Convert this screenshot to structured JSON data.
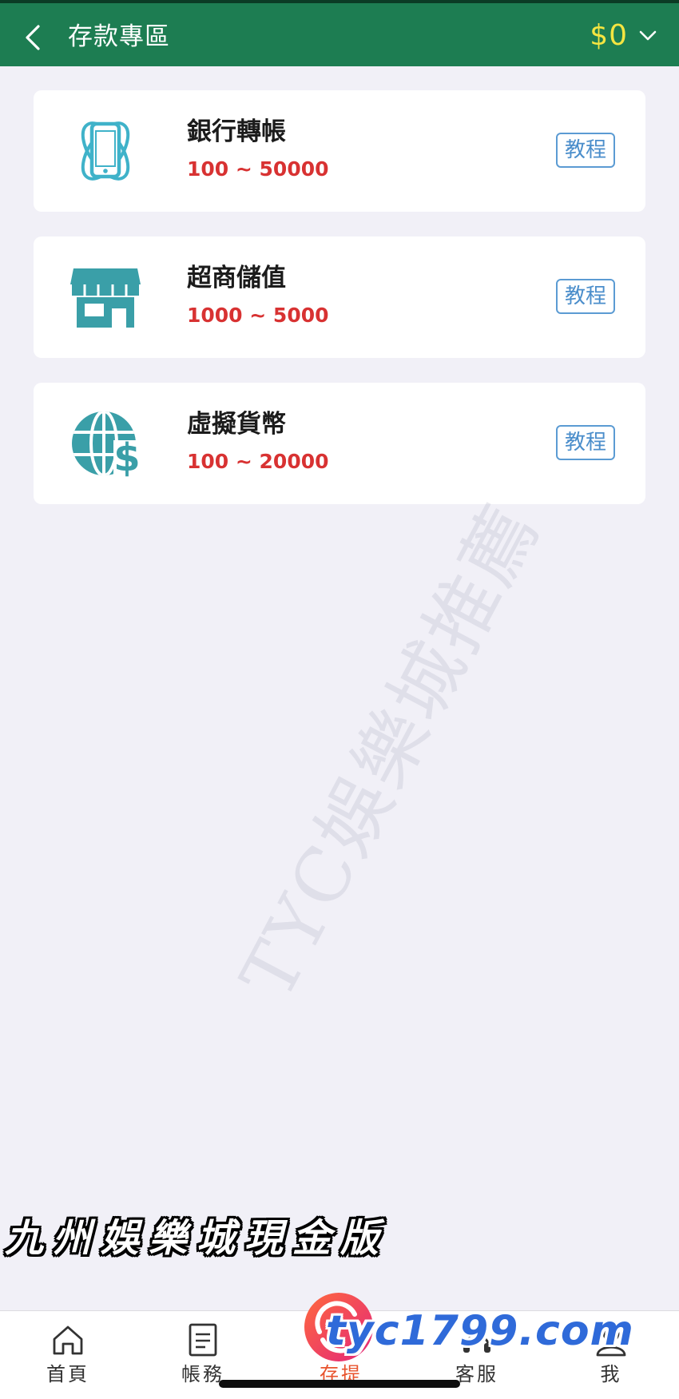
{
  "header": {
    "title": "存款專區",
    "balance": "$0"
  },
  "deposit_methods": [
    {
      "name": "銀行轉帳",
      "range": "100 ~ 50000",
      "tutorial_label": "教程",
      "icon": "phone-transfer-icon"
    },
    {
      "name": "超商儲值",
      "range": "1000 ~ 5000",
      "tutorial_label": "教程",
      "icon": "store-icon"
    },
    {
      "name": "虛擬貨幣",
      "range": "100 ~ 20000",
      "tutorial_label": "教程",
      "icon": "globe-dollar-icon"
    }
  ],
  "bottom_nav": {
    "items": [
      {
        "label": "首頁",
        "icon": "home-icon"
      },
      {
        "label": "帳務",
        "icon": "document-icon"
      },
      {
        "label": "存提",
        "icon": "deposit-icon",
        "active": true
      },
      {
        "label": "客服",
        "icon": "support-icon"
      },
      {
        "label": "我",
        "icon": "user-icon"
      }
    ]
  },
  "watermarks": {
    "diagonal": "TYC娛樂城推薦",
    "bottom_left": "九州娛樂城現金版",
    "bottom_right": "tyc1799.com"
  },
  "colors": {
    "header_bg": "#1d7d52",
    "balance": "#f4e541",
    "icon_teal": "#3a9fa8",
    "range_red": "#d83232",
    "tutorial_blue": "#4b8ecb",
    "active_nav": "#e8532d",
    "page_bg": "#f1f0f7"
  }
}
